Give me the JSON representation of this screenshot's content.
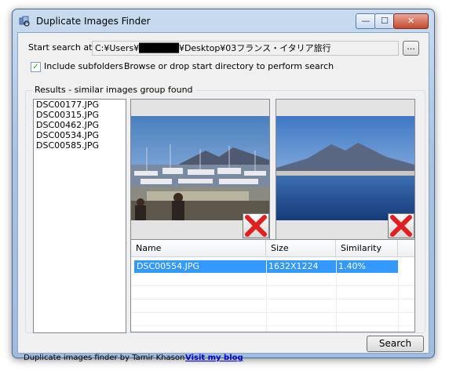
{
  "window": {
    "title": "Duplicate Images Finder",
    "close_glyph": "✕",
    "min_glyph": "—",
    "max_glyph": "☐"
  },
  "search": {
    "start_label": "Start search at:",
    "path_value": "C:¥Users¥██████¥Desktop¥03フランス・イタリア旅行",
    "browse_label": "...",
    "include_subfolders_label": "Include subfolders",
    "include_subfolders_checked": true,
    "hint": "Browse or drop start directory to perform search"
  },
  "results": {
    "group_title": "Results - similar images group found",
    "files": [
      "DSC00177.JPG",
      "DSC00315.JPG",
      "DSC00462.JPG",
      "DSC00534.JPG",
      "DSC00585.JPG"
    ]
  },
  "grid": {
    "columns": [
      "Name",
      "Size",
      "Similarity"
    ],
    "rows": [
      {
        "name": "DSC00554.JPG",
        "size": "1632X1224",
        "similarity": "1.40%"
      }
    ]
  },
  "search_button": "Search",
  "footer": {
    "credit": "Duplicate images finder by Tamir Khason",
    "link": "Visit my blog"
  },
  "icons": {
    "app": "app-icon",
    "delete": "red-x-delete-icon"
  },
  "colors": {
    "selection": "#3399ff",
    "link": "#0000cc",
    "delete_red": "#e02020"
  }
}
